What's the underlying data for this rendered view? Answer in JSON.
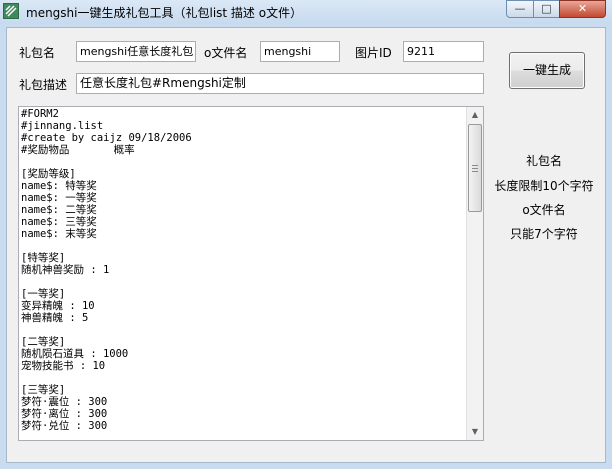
{
  "window": {
    "title": "mengshi一键生成礼包工具（礼包list 描述 o文件）",
    "min_glyph": "—",
    "max_glyph": "□",
    "close_glyph": "✕"
  },
  "form": {
    "pack_name_label": "礼包名",
    "pack_name_value": "mengshi任意长度礼包",
    "file_name_label": "o文件名",
    "file_name_value": "mengshi",
    "image_id_label": "图片ID",
    "image_id_value": "9211",
    "desc_label": "礼包描述",
    "desc_value": "任意长度礼包#Rmengshi定制",
    "generate_button": "一键生成"
  },
  "editor": {
    "lines": [
      "#FORM2",
      "#jinnang.list",
      "#create by caijz 09/18/2006",
      "#奖励物品       概率",
      "",
      "[奖励等级]",
      "name$: 特等奖",
      "name$: 一等奖",
      "name$: 二等奖",
      "name$: 三等奖",
      "name$: 末等奖",
      "",
      "[特等奖]",
      "随机神兽奖励 : 1",
      "",
      "[一等奖]",
      "变异精魄 : 10",
      "神兽精魄 : 5",
      "",
      "[二等奖]",
      "随机陨石道具 : 1000",
      "宠物技能书 : 10",
      "",
      "[三等奖]",
      "梦符·震位 : 300",
      "梦符·离位 : 300",
      "梦符·兑位 : 300"
    ]
  },
  "hints": [
    "礼包名",
    "长度限制10个字符",
    "o文件名",
    "只能7个字符"
  ]
}
